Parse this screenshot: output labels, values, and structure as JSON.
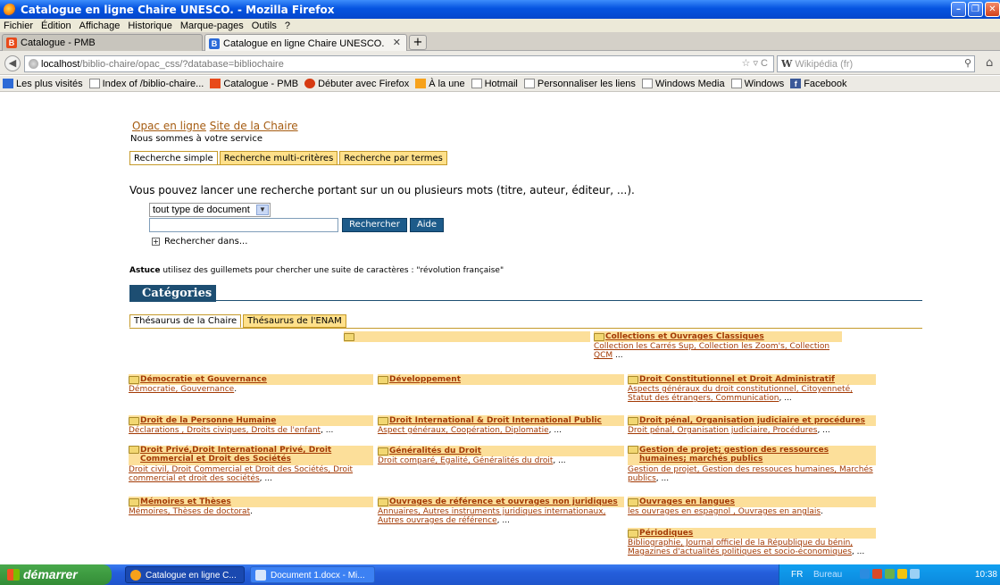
{
  "window": {
    "title": "Catalogue en ligne Chaire UNESCO. - Mozilla Firefox"
  },
  "menu": [
    "Fichier",
    "Édition",
    "Affichage",
    "Historique",
    "Marque-pages",
    "Outils",
    "?"
  ],
  "tabs": [
    {
      "label": "Catalogue - PMB",
      "active": false
    },
    {
      "label": "Catalogue en ligne Chaire UNESCO.",
      "active": true
    }
  ],
  "newtab_label": "+",
  "nav": {
    "url_host": "localhost",
    "url_path": "/biblio-chaire/opac_css/?database=bibliochaire",
    "search_engine": "W",
    "search_placeholder": "Wikipédia (fr)"
  },
  "bookmarks": [
    {
      "label": "Les plus visités",
      "icon": "blue"
    },
    {
      "label": "Index of /biblio-chaire...",
      "icon": "page"
    },
    {
      "label": "Catalogue - PMB",
      "icon": "red"
    },
    {
      "label": "Débuter avec Firefox",
      "icon": "fire"
    },
    {
      "label": "À la une",
      "icon": "rss"
    },
    {
      "label": "Hotmail",
      "icon": "page"
    },
    {
      "label": "Personnaliser les liens",
      "icon": "page"
    },
    {
      "label": "Windows Media",
      "icon": "page"
    },
    {
      "label": "Windows",
      "icon": "page"
    },
    {
      "label": "Facebook",
      "icon": "fb"
    }
  ],
  "page": {
    "link_opac": "Opac en ligne",
    "link_site": "Site de la Chaire",
    "service": "Nous sommes à votre service",
    "search_tabs": [
      "Recherche simple",
      "Recherche multi-critères",
      "Recherche par termes"
    ],
    "intro": "Vous pouvez lancer une recherche portant sur un ou plusieurs mots (titre, auteur, éditeur, ...).",
    "doctype_value": "tout type de document",
    "btn_search": "Rechercher",
    "btn_help": "Aide",
    "search_in": "Rechercher dans...",
    "astuce_label": "Astuce",
    "astuce_text": " utilisez des guillemets pour chercher une suite de caractères : \"révolution française\"",
    "categories_title": "Catégories",
    "thesaurus_tabs": [
      "Thésaurus de la Chaire",
      "Thésaurus de l'ENAM"
    ]
  },
  "categories": {
    "empty": {
      "title": ""
    },
    "collections": {
      "title": "Collections et Ouvrages Classiques",
      "subs": "Collection les Carrés Sup, Collection les Zoom's, Collection QCM",
      "more": " ..."
    },
    "democratie": {
      "title": "Démocratie et Gouvernance",
      "subs": "Démocratie, Gouvernance",
      "more": "."
    },
    "developpement": {
      "title": "Développement",
      "subs": "",
      "more": ""
    },
    "droit_const": {
      "title": "Droit Constitutionnel et Droit Administratif",
      "subs": "Aspects généraux du droit constitutionnel, Citoyenneté, Statut des étrangers, Communication",
      "more": ", ..."
    },
    "droit_personne": {
      "title": "Droit de la Personne Humaine",
      "subs": "Déclarations , Droits civiques, Droits de l'enfant",
      "more": ", ..."
    },
    "droit_intl": {
      "title": "Droit International & Droit International Public",
      "subs": "Aspect généraux, Coopération, Diplomatie",
      "more": ", ..."
    },
    "droit_penal": {
      "title": "Droit pénal, Organisation judiciaire et procédures",
      "subs": "Droit pénal, Organisation judiciaire, Procédures",
      "more": ", ..."
    },
    "droit_prive": {
      "title": "Droit Privé,Droit International Privé, Droit Commercial et Droit des Sociétés",
      "subs": "Droit civil, Droit Commercial et Droit des Sociétés, Droit commercial et droit des sociétés",
      "more": ", ..."
    },
    "generalites": {
      "title": "Généralités du Droit",
      "subs": "Droit comparé, Egalité, Généralités du droit",
      "more": ", ..."
    },
    "gestion": {
      "title": "Gestion de projet; gestion des ressources humaines; marchés publics",
      "subs": "Gestion de projet, Gestion des ressouces humaines, Marchés publics",
      "more": ", ..."
    },
    "memoires": {
      "title": "Mémoires et Thèses",
      "subs": "Mémoires, Thèses de doctorat",
      "more": "."
    },
    "ouvrages_ref": {
      "title": "Ouvrages de référence et ouvrages non juridiques",
      "subs": "Annuaires, Autres instruments juridiques internationaux, Autres ouvrages de référence",
      "more": ", ..."
    },
    "ouvrages_langues": {
      "title": "Ouvrages en langues",
      "subs": "les ouvrages en espagnol , Ouvrages en anglais",
      "more": "."
    },
    "periodiques": {
      "title": "Périodiques",
      "subs": "Bibliographie, Journal officiel de la République du bénin, Magazines d'actualités politiques et socio-économiques",
      "more": ", ..."
    }
  },
  "taskbar": {
    "start": "démarrer",
    "tasks": [
      "Catalogue en ligne C...",
      "Document 1.docx - Mi..."
    ],
    "lang": "FR",
    "bureau": "Bureau",
    "clock": "10:38"
  }
}
